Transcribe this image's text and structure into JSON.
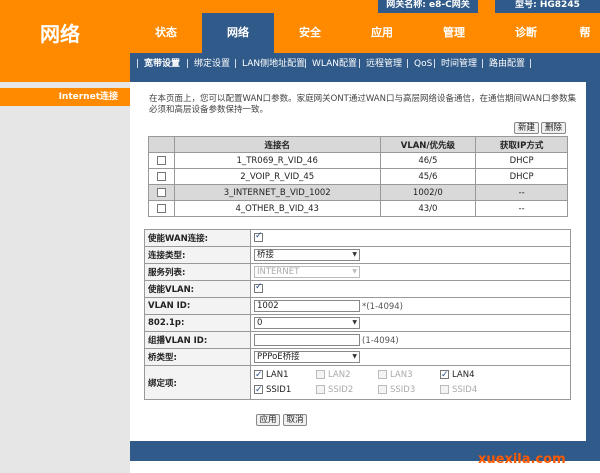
{
  "header": {
    "brand": "网络",
    "gateway_name": "网关名称: e8-C网关",
    "model": "型号: HG8245"
  },
  "nav": {
    "items": [
      {
        "label": "状态"
      },
      {
        "label": "网络"
      },
      {
        "label": "安全"
      },
      {
        "label": "应用"
      },
      {
        "label": "管理"
      },
      {
        "label": "诊断"
      },
      {
        "label": "帮"
      }
    ]
  },
  "subnav": {
    "items": [
      {
        "label": "宽带设置"
      },
      {
        "label": "绑定设置"
      },
      {
        "label": "LAN侧地址配置"
      },
      {
        "label": "WLAN配置"
      },
      {
        "label": "远程管理"
      },
      {
        "label": "QoS"
      },
      {
        "label": "时间管理"
      },
      {
        "label": "路由配置"
      }
    ]
  },
  "leftmenu": {
    "active": "Internet连接"
  },
  "intro": "在本页面上，您可以配置WAN口参数。家庭网关ONT通过WAN口与高层网络设备通信，在通信期间WAN口参数集必须和高层设备参数保持一致。",
  "buttons": {
    "new": "新建",
    "delete": "删除",
    "apply": "应用",
    "cancel": "取消"
  },
  "wan_table": {
    "headers": [
      "连接名",
      "VLAN/优先级",
      "获取IP方式"
    ],
    "rows": [
      {
        "name": "1_TR069_R_VID_46",
        "vlan": "46/5",
        "ip": "DHCP"
      },
      {
        "name": "2_VOIP_R_VID_45",
        "vlan": "45/6",
        "ip": "DHCP"
      },
      {
        "name": "3_INTERNET_B_VID_1002",
        "vlan": "1002/0",
        "ip": "--"
      },
      {
        "name": "4_OTHER_B_VID_43",
        "vlan": "43/0",
        "ip": "--"
      }
    ]
  },
  "form": {
    "enable_wan": {
      "label": "使能WAN连接:"
    },
    "conn_type": {
      "label": "连接类型:",
      "value": "桥接"
    },
    "service_list": {
      "label": "服务列表:",
      "value": "INTERNET"
    },
    "enable_vlan": {
      "label": "使能VLAN:"
    },
    "vlan_id": {
      "label": "VLAN ID:",
      "value": "1002",
      "hint": "*(1-4094)"
    },
    "p8021": {
      "label": "802.1p:",
      "value": "0"
    },
    "mcast_vlan": {
      "label": "组播VLAN ID:",
      "value": "",
      "hint": "(1-4094)"
    },
    "bridge_type": {
      "label": "桥类型:",
      "value": "PPPoE桥接"
    },
    "binding": {
      "label": "绑定项:",
      "row1": [
        {
          "label": "LAN1"
        },
        {
          "label": "LAN2"
        },
        {
          "label": "LAN3"
        },
        {
          "label": "LAN4"
        }
      ],
      "row2": [
        {
          "label": "SSID1"
        },
        {
          "label": "SSID2"
        },
        {
          "label": "SSID3"
        },
        {
          "label": "SSID4"
        }
      ]
    }
  },
  "watermark": "xuexila.com"
}
